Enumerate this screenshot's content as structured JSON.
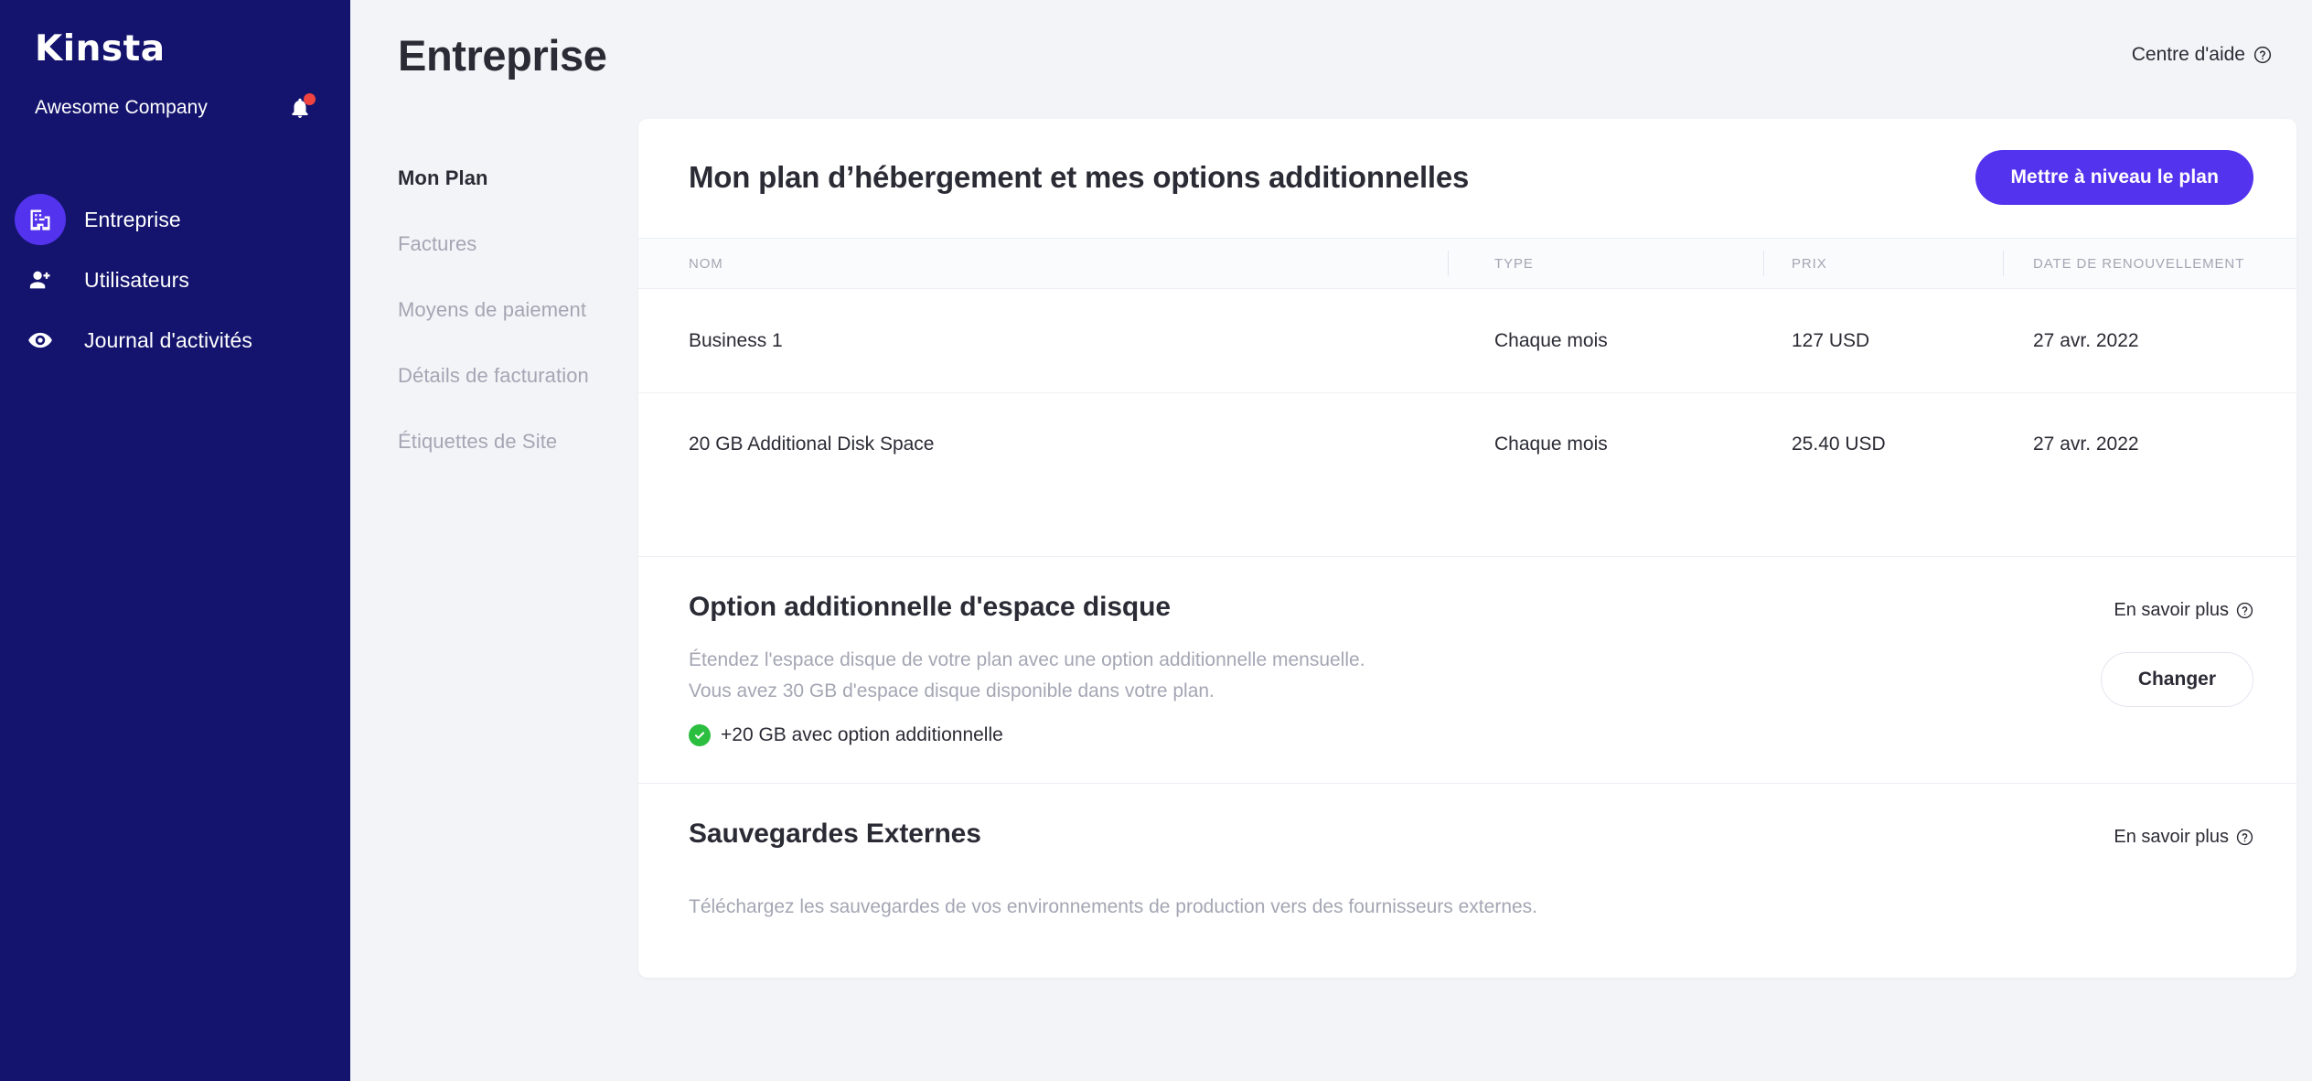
{
  "sidebar": {
    "logo": "Kinsta",
    "company": "Awesome Company",
    "bell_icon": "bell-icon",
    "items": [
      {
        "label": "Entreprise",
        "icon": "building-icon",
        "active": true
      },
      {
        "label": "Utilisateurs",
        "icon": "user-plus-icon",
        "active": false
      },
      {
        "label": "Journal d'activités",
        "icon": "eye-icon",
        "active": false
      }
    ]
  },
  "header": {
    "title": "Entreprise",
    "help_label": "Centre d'aide",
    "help_icon": "question-circle-icon"
  },
  "subnav": {
    "items": [
      {
        "label": "Mon Plan",
        "active": true
      },
      {
        "label": "Factures",
        "active": false
      },
      {
        "label": "Moyens de paiement",
        "active": false
      },
      {
        "label": "Détails de facturation",
        "active": false
      },
      {
        "label": "Étiquettes de Site",
        "active": false
      }
    ]
  },
  "card": {
    "title": "Mon plan d’hébergement et mes options additionnelles",
    "upgrade_button": "Mettre à niveau le plan"
  },
  "table": {
    "columns": [
      "NOM",
      "TYPE",
      "PRIX",
      "DATE DE RENOUVELLEMENT"
    ],
    "rows": [
      {
        "nom": "Business 1",
        "type": "Chaque mois",
        "prix": "127 USD",
        "date": "27 avr. 2022"
      },
      {
        "nom": "20 GB Additional Disk Space",
        "type": "Chaque mois",
        "prix": "25.40 USD",
        "date": "27 avr. 2022"
      }
    ]
  },
  "disk_section": {
    "title": "Option additionnelle d'espace disque",
    "learn_more": "En savoir plus",
    "learn_more_icon": "question-circle-icon",
    "line1": "Étendez l'espace disque de votre plan avec une option additionnelle mensuelle.",
    "line2": "Vous avez 30 GB d'espace disque disponible dans votre plan.",
    "badge": "+20 GB avec option additionnelle",
    "badge_icon": "check-circle-icon",
    "change_button": "Changer"
  },
  "backups_section": {
    "title": "Sauvegardes Externes",
    "learn_more": "En savoir plus",
    "learn_more_icon": "question-circle-icon",
    "line1": "Téléchargez les sauvegardes de vos environnements de production vers des fournisseurs externes."
  },
  "colors": {
    "sidebar_bg": "#14146e",
    "accent": "#5333ed",
    "page_bg": "#f3f4f8",
    "badge_red": "#f1433f",
    "success_green": "#2cbf3f",
    "muted_text": "#a4a6b3",
    "dark_text": "#2b2b35"
  }
}
